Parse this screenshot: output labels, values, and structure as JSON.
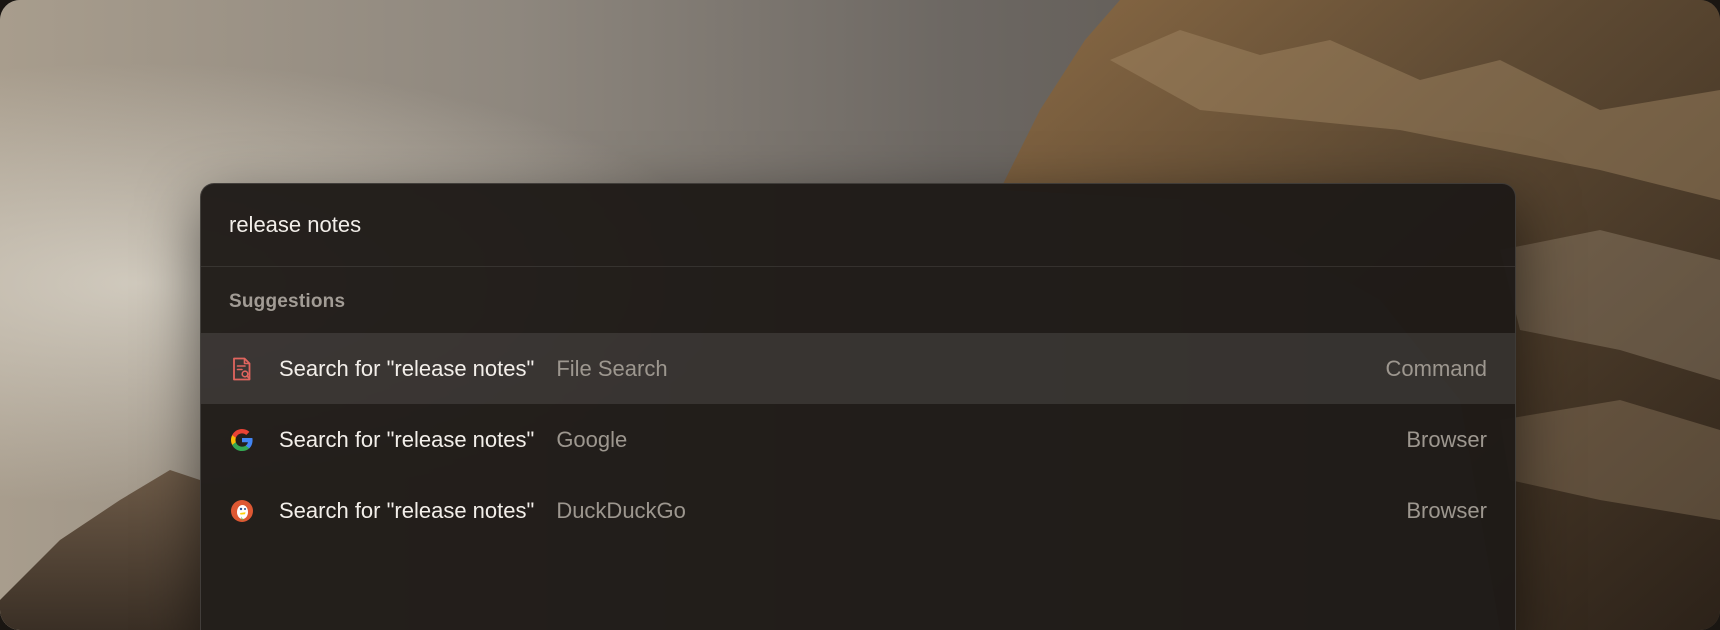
{
  "search": {
    "value": "release notes"
  },
  "suggestions": {
    "section_label": "Suggestions",
    "items": [
      {
        "icon": "file-search-icon",
        "title": "Search for \"release notes\"",
        "subtitle": "File Search",
        "type": "Command",
        "selected": true
      },
      {
        "icon": "google-icon",
        "title": "Search for \"release notes\"",
        "subtitle": "Google",
        "type": "Browser",
        "selected": false
      },
      {
        "icon": "duckduckgo-icon",
        "title": "Search for \"release notes\"",
        "subtitle": "DuckDuckGo",
        "type": "Browser",
        "selected": false
      }
    ]
  },
  "colors": {
    "accent_file_search": "#e0655e",
    "google_blue": "#4285F4",
    "google_red": "#EA4335",
    "google_yellow": "#FBBC05",
    "google_green": "#34A853",
    "duckduckgo_orange": "#de5833"
  }
}
